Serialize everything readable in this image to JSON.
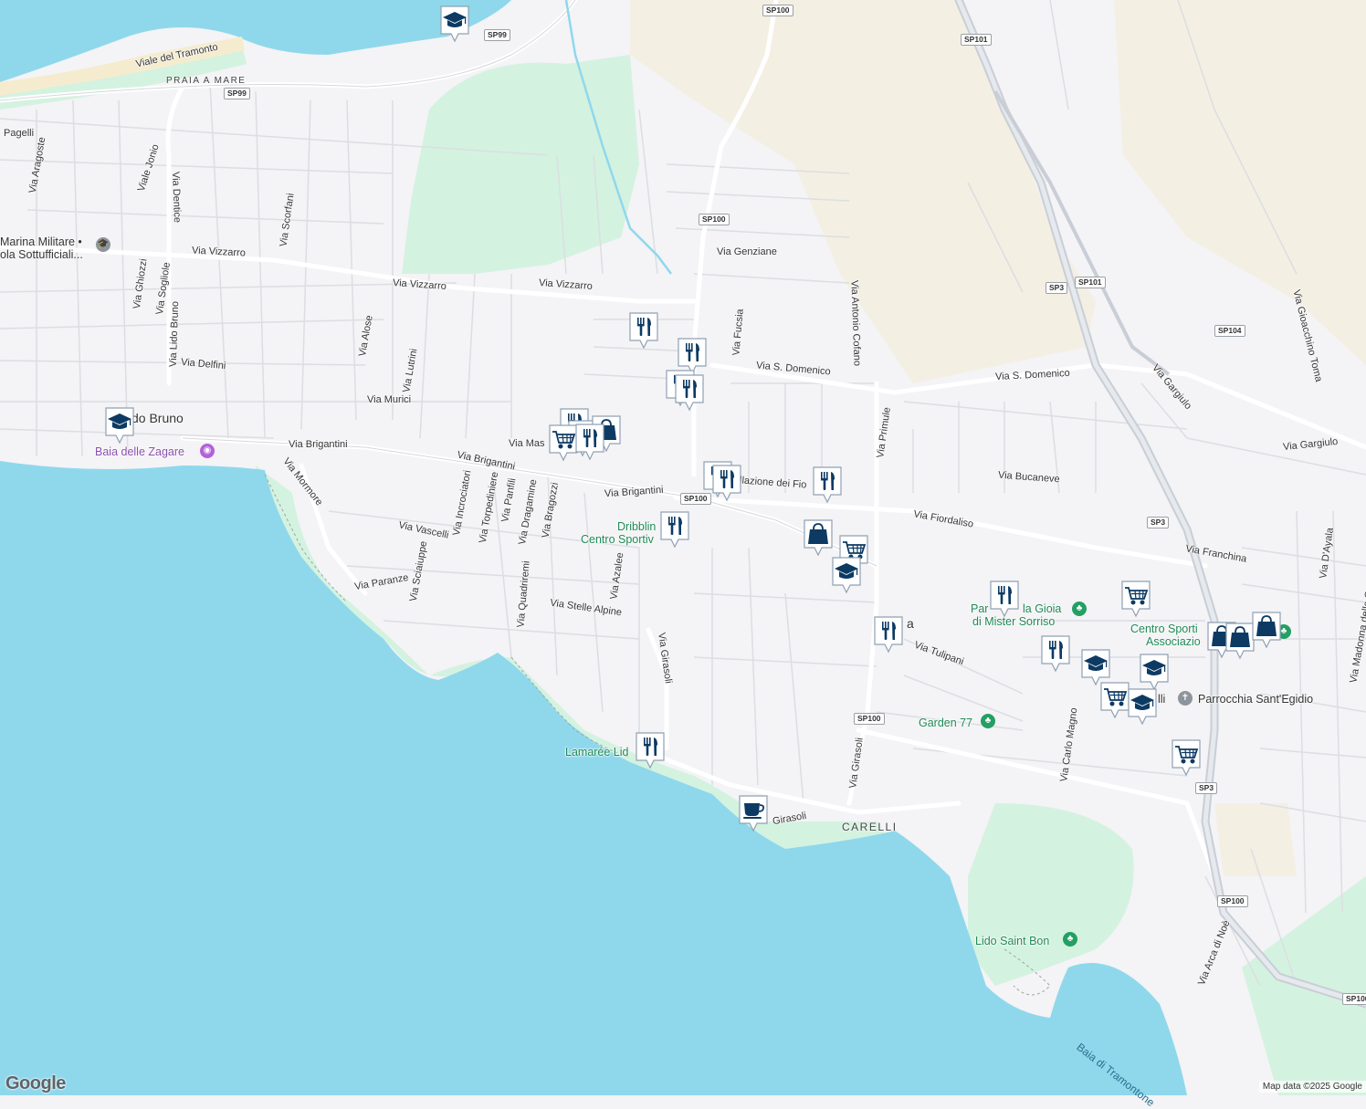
{
  "colors": {
    "water": "#8fd8ec",
    "park": "#d4f2e0",
    "land": "#f4f3f6",
    "beige": "#f4efe3",
    "road": "#ffffff",
    "road_stroke": "#d6d8dc",
    "highway": "#c9ced6",
    "marker_blue": "#0c3a63"
  },
  "shields": [
    {
      "text": "SP100"
    },
    {
      "text": "SP99"
    },
    {
      "text": "SP99"
    },
    {
      "text": "SP101"
    },
    {
      "text": "SP100"
    },
    {
      "text": "SP101"
    },
    {
      "text": "SP3"
    },
    {
      "text": "SP104"
    },
    {
      "text": "SP100"
    },
    {
      "text": "SP3"
    },
    {
      "text": "SP100"
    },
    {
      "text": "SP3"
    },
    {
      "text": "SP100"
    },
    {
      "text": "SP100"
    }
  ],
  "streets": [
    "Viale del Tramonto",
    "Pagelli",
    "Via Aragoste",
    "Viale Jonio",
    "Via Dentice",
    "Via Scorfani",
    "Via Vizzarro",
    "Via Vizzarro",
    "Via Vizzarro",
    "Via Ghiozzi",
    "Via Sogliole",
    "Via Lido Bruno",
    "Via Alose",
    "Via Lutrini",
    "Via Delfini",
    "Via Murici",
    "Via Brigantini",
    "Via Brigantini",
    "Via Brigantini",
    "Via Mormore",
    "Via Incrociatori",
    "Via Torpediniere",
    "Via Panfili",
    "Via Dragamine",
    "Via Bragozzi",
    "Via Vascelli",
    "Via Sciaiuppe",
    "Via Quadriremi",
    "Via Paranze",
    "Via Stelle Alpine",
    "Via Azalee",
    "Via Girasoli",
    "Via Mas",
    "Via Genziane",
    "Via Fucsia",
    "Via S. Domenico",
    "Via S. Domenico",
    "Via Antonio Cofano",
    "Via Primule",
    "Via Bucaneve",
    "Via Fiordaliso",
    "Via Tulipani",
    "Via Girasoli",
    "Via Carlo Magno",
    "Via Gargiulo",
    "Via Gargiulo",
    "Via Gioacchino Toma",
    "Via Franchina",
    "Via D'Ayala",
    "Via Madonna delle Grazie",
    "Via Arca di Noè",
    "Girasoli",
    "llazione dei Fio"
  ],
  "places": [
    "PRAIA A MARE",
    "CARELLI"
  ],
  "pois": [
    {
      "text": "Marina Militare •",
      "style": "dark"
    },
    {
      "text": "ola Sottufficiali...",
      "style": "dark"
    },
    {
      "text": "do Bruno",
      "style": "dark"
    },
    {
      "text": "Baia delle Zagare",
      "style": "purple"
    },
    {
      "text": "Dribblin",
      "style": "green"
    },
    {
      "text": "Centro Sportiv",
      "style": "green"
    },
    {
      "text": "Lamarée Lid",
      "style": "green"
    },
    {
      "text": "Par",
      "style": "green"
    },
    {
      "text": "la Gioia",
      "style": "green"
    },
    {
      "text": "di Mister Sorriso",
      "style": "green"
    },
    {
      "text": "Centro Sporti",
      "style": "green"
    },
    {
      "text": "Associazio",
      "style": "green"
    },
    {
      "text": "Parrocchia Sant'Egidio",
      "style": "dark"
    },
    {
      "text": "Garden 77",
      "style": "green"
    },
    {
      "text": "Lido Saint Bon",
      "style": "green"
    },
    {
      "text": "a",
      "style": "dark"
    },
    {
      "text": "lli",
      "style": "dark"
    }
  ],
  "water_labels": [
    "Baia di Tramontone"
  ],
  "markers": [
    {
      "icon": "school-icon"
    },
    {
      "icon": "school-icon"
    },
    {
      "icon": "restaurant-icon"
    },
    {
      "icon": "restaurant-icon"
    },
    {
      "icon": "restaurant-icon"
    },
    {
      "icon": "restaurant-icon"
    },
    {
      "icon": "restaurant-icon"
    },
    {
      "icon": "restaurant-icon"
    },
    {
      "icon": "shopping-bag-icon"
    },
    {
      "icon": "shopping-cart-icon"
    },
    {
      "icon": "restaurant-icon"
    },
    {
      "icon": "restaurant-icon"
    },
    {
      "icon": "restaurant-icon"
    },
    {
      "icon": "restaurant-icon"
    },
    {
      "icon": "shopping-bag-icon"
    },
    {
      "icon": "shopping-cart-icon"
    },
    {
      "icon": "school-icon"
    },
    {
      "icon": "restaurant-icon"
    },
    {
      "icon": "restaurant-icon"
    },
    {
      "icon": "shopping-cart-icon"
    },
    {
      "icon": "restaurant-icon"
    },
    {
      "icon": "restaurant-icon"
    },
    {
      "icon": "school-icon"
    },
    {
      "icon": "school-icon"
    },
    {
      "icon": "shopping-cart-icon"
    },
    {
      "icon": "school-icon"
    },
    {
      "icon": "shopping-cart-icon"
    },
    {
      "icon": "shopping-bag-icon"
    },
    {
      "icon": "shopping-bag-icon"
    },
    {
      "icon": "shopping-bag-icon"
    },
    {
      "icon": "restaurant-icon"
    },
    {
      "icon": "coffee-icon"
    }
  ],
  "attribution": {
    "logo": "Google",
    "text": "Map data ©2025 Google"
  }
}
